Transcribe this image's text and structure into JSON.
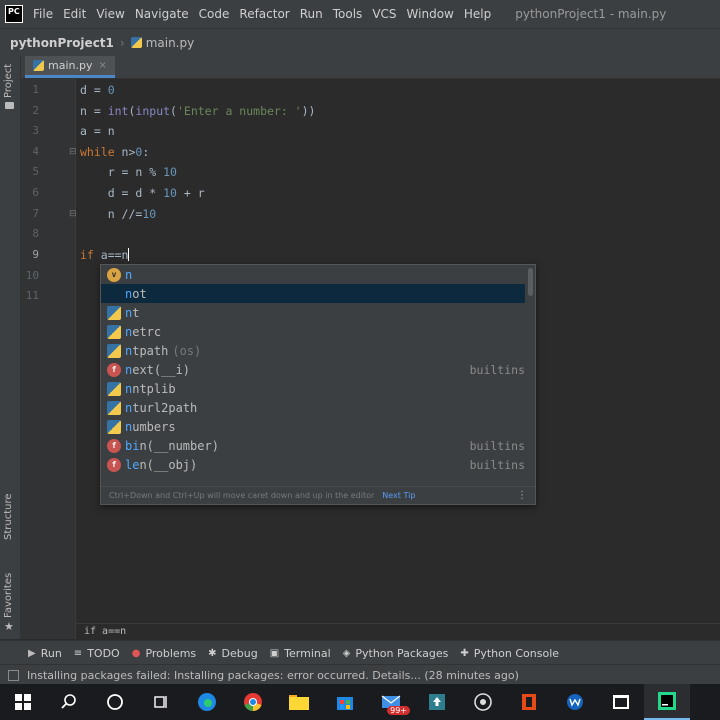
{
  "menubar": {
    "logo": "PC",
    "items": [
      "File",
      "Edit",
      "View",
      "Navigate",
      "Code",
      "Refactor",
      "Run",
      "Tools",
      "VCS",
      "Window",
      "Help"
    ],
    "window_title": "pythonProject1 - main.py"
  },
  "breadcrumb": {
    "project": "pythonProject1",
    "file": "main.py"
  },
  "left_strip": {
    "project": "Project",
    "structure": "Structure",
    "favorites": "Favorites"
  },
  "tabs": [
    {
      "label": "main.py",
      "close": "×"
    }
  ],
  "editor": {
    "line_numbers": [
      "1",
      "2",
      "3",
      "4",
      "5",
      "6",
      "7",
      "8",
      "9",
      "10",
      "11"
    ],
    "code": {
      "l1_a": "d = ",
      "l1_b": "0",
      "l2_a": "n = ",
      "l2_b": "int",
      "l2_c": "(",
      "l2_d": "input",
      "l2_e": "(",
      "l2_f": "'Enter a number: '",
      "l2_g": "))",
      "l3": "a = n",
      "l4_a": "while",
      "l4_b": " n>",
      "l4_c": "0",
      "l4_d": ":",
      "l5_a": "    r = n % ",
      "l5_b": "10",
      "l6_a": "    d = d * ",
      "l6_b": "10",
      "l6_c": " + r",
      "l7_a": "    n //=",
      "l7_b": "10",
      "l9_a": "if",
      "l9_b": " a==n"
    }
  },
  "completion": {
    "items": [
      {
        "icon": "v",
        "match": "n",
        "rest": "",
        "hint": "",
        "type": ""
      },
      {
        "icon": "none",
        "match": "n",
        "rest": "ot",
        "hint": "",
        "type": ""
      },
      {
        "icon": "m",
        "match": "n",
        "rest": "t",
        "hint": "",
        "type": ""
      },
      {
        "icon": "m",
        "match": "n",
        "rest": "etrc",
        "hint": "",
        "type": ""
      },
      {
        "icon": "m",
        "match": "n",
        "rest": "tpath",
        "hint": "(os)",
        "type": ""
      },
      {
        "icon": "f",
        "match": "n",
        "rest": "ext(__i)",
        "hint": "",
        "type": "builtins"
      },
      {
        "icon": "m",
        "match": "n",
        "rest": "ntplib",
        "hint": "",
        "type": ""
      },
      {
        "icon": "m",
        "match": "n",
        "rest": "turl2path",
        "hint": "",
        "type": ""
      },
      {
        "icon": "m",
        "match": "n",
        "rest": "umbers",
        "hint": "",
        "type": ""
      },
      {
        "icon": "f",
        "match": "bi",
        "rest": "n(__number)",
        "hint": "",
        "type": "builtins"
      },
      {
        "icon": "f",
        "match": "le",
        "rest": "n(__obj)",
        "hint": "",
        "type": "builtins"
      }
    ],
    "footer": "Ctrl+Down and Ctrl+Up will move caret down and up in the editor",
    "next_tip": "Next Tip",
    "kebab": "⋮"
  },
  "code_crumb": "if a==n",
  "tool_windows": [
    {
      "icon": "▶",
      "label": "Run"
    },
    {
      "icon": "≡",
      "label": "TODO"
    },
    {
      "icon": "●",
      "label": "Problems"
    },
    {
      "icon": "✱",
      "label": "Debug"
    },
    {
      "icon": "▣",
      "label": "Terminal"
    },
    {
      "icon": "◈",
      "label": "Python Packages"
    },
    {
      "icon": "✚",
      "label": "Python Console"
    }
  ],
  "status": {
    "message": "Installing packages failed: Installing packages: error occurred. Details... (28 minutes ago)"
  },
  "taskbar": {
    "badge": "99+"
  },
  "colors": {
    "accent": "#4a88c7",
    "keyword": "#cc7832",
    "number": "#6897bb",
    "string": "#6a8759",
    "builtin": "#8888c6"
  }
}
